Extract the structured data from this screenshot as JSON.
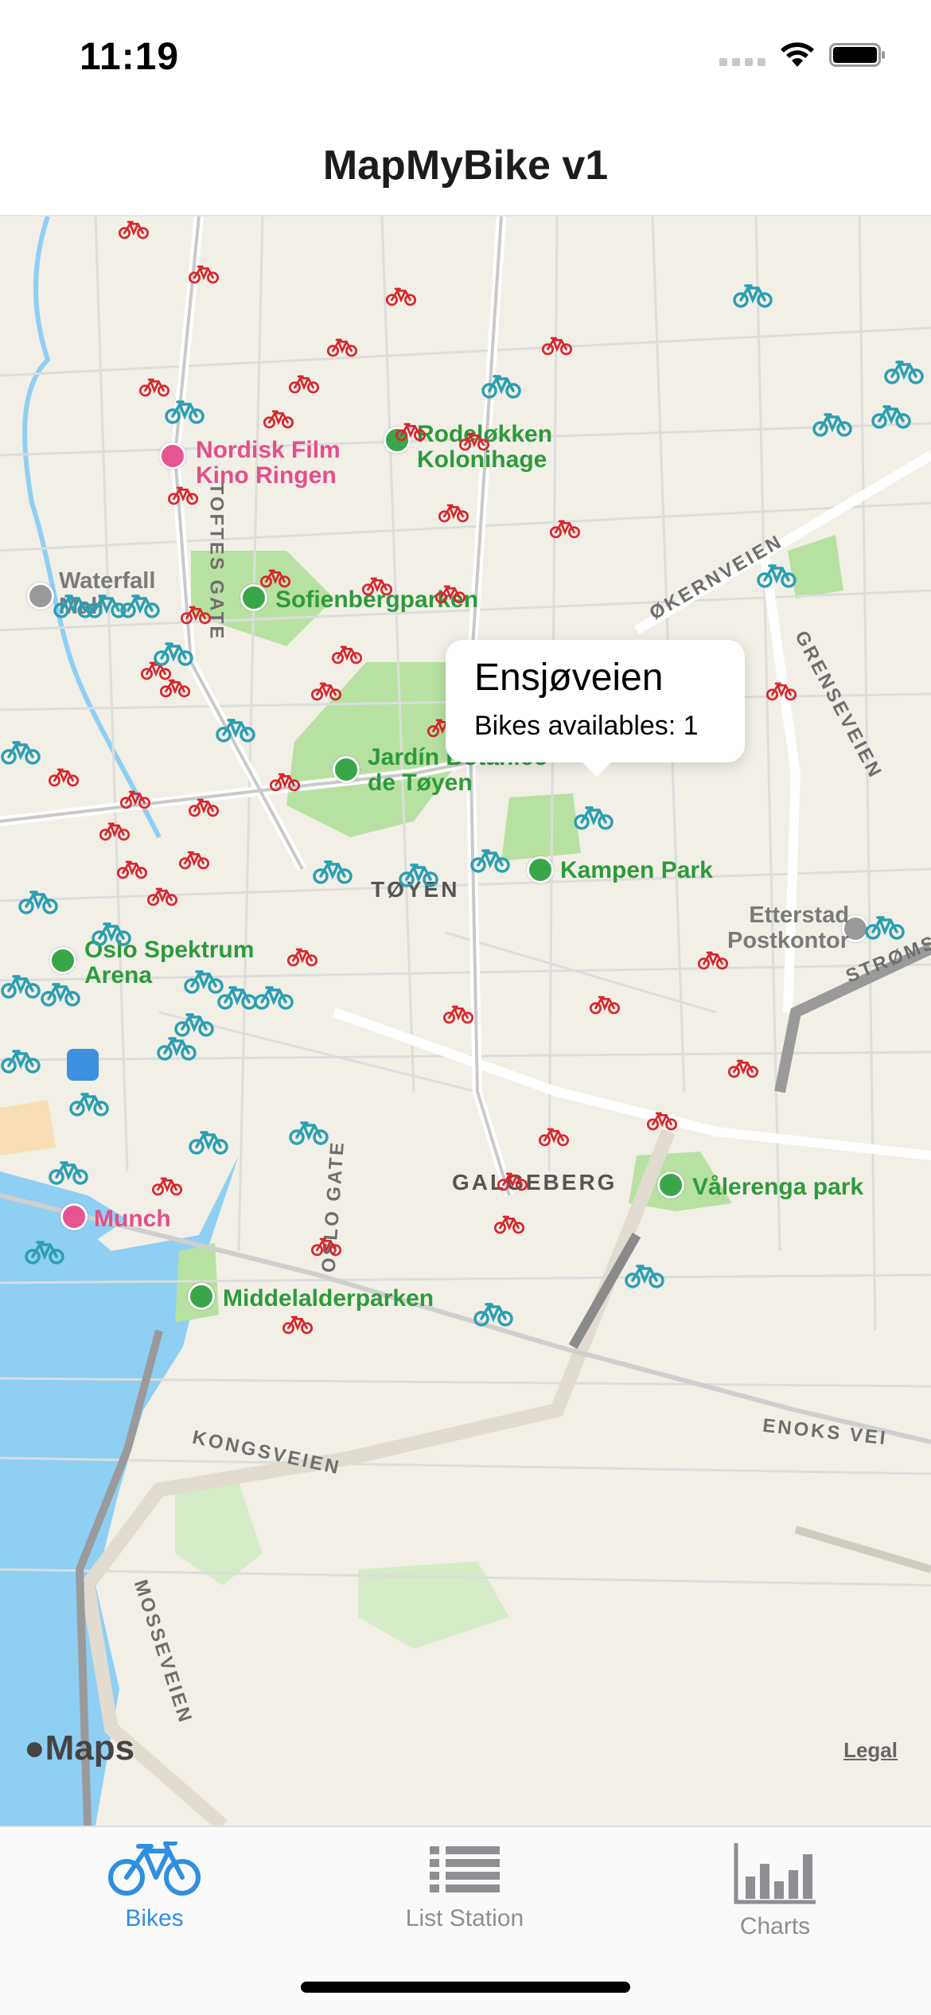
{
  "status_bar": {
    "time": "11:19"
  },
  "nav": {
    "title": "MapMyBike v1"
  },
  "map": {
    "labels": {
      "nordisk_film": "Nordisk Film\nKino Ringen",
      "rodelokken": "Rodeløkken\nKolonihage",
      "sofienbergparken": "Sofienbergparken",
      "waterfall": "Waterfall\nMall",
      "jardin": "Jardín Botanico\nde Tøyen",
      "toyen": "TØYEN",
      "kampen_park": "Kampen Park",
      "oslo_spektrum": "Oslo Spektrum\nArena",
      "etterstad": "Etterstad\nPostkontor",
      "galgeberg": "GALGEBERG",
      "valerenga_park": "Vålerenga park",
      "munch": "Munch",
      "middelalderparken": "Middelalderparken",
      "kongsveien": "KONGSVEIEN",
      "enoks_vei": "ENOKS VEI",
      "mosseveien": "MOSSEVEIEN",
      "tofte_gate": "TOFTES GATE",
      "oslo_gate": "OSLO GATE",
      "okernveien": "ØKERNVEIEN",
      "grenseveien": "GRENSEVEIEN",
      "stromsveien": "STRØMS"
    },
    "brand": "Maps",
    "legal": "Legal"
  },
  "callout": {
    "title": "Ensjøveien",
    "subtitle": "Bikes availables: 1"
  },
  "tabs": [
    {
      "label": "Bikes",
      "icon": "bicycle-icon",
      "active": true
    },
    {
      "label": "List Station",
      "icon": "list-icon",
      "active": false
    },
    {
      "label": "Charts",
      "icon": "bar-chart-icon",
      "active": false
    }
  ],
  "colors": {
    "accent": "#2f8fe0",
    "bike_available": "#2b9fb3",
    "bike_empty": "#d9262c",
    "park": "#b7e1a1",
    "water": "#8ecff3"
  }
}
